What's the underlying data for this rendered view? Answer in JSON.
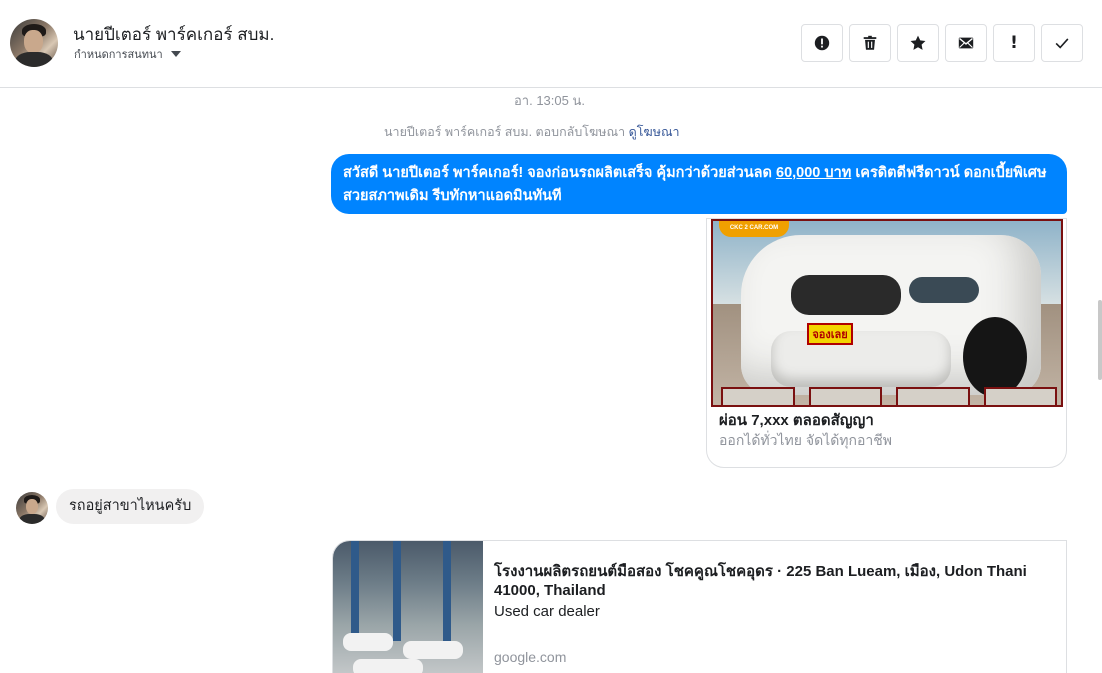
{
  "header": {
    "contact_name": "นายปีเตอร์ พาร์คเกอร์ สบม.",
    "settings_label": "กำหนดการสนทนา",
    "toolbar": [
      {
        "icon": "alert-circle-icon",
        "label": "report"
      },
      {
        "icon": "trash-icon",
        "label": "delete"
      },
      {
        "icon": "star-icon",
        "label": "star"
      },
      {
        "icon": "envelope-icon",
        "label": "mark-unread"
      },
      {
        "icon": "exclamation-icon",
        "label": "!"
      },
      {
        "icon": "check-icon",
        "label": "done"
      }
    ]
  },
  "thread": {
    "timestamp": "อา. 13:05 น.",
    "ad_reply_prefix": "นายปีเตอร์ พาร์คเกอร์ สบม. ตอบกลับโฆษณา",
    "ad_reply_link": "ดูโฆษณา",
    "outgoing": {
      "text_before": "สวัสดี นายปีเตอร์ พาร์คเกอร์! จองก่อนรถผลิตเสร็จ คุ้มกว่าด้วยส่วนลด ",
      "highlight": "60,000 บาท",
      "text_after": " เครดิตดีฟรีดาวน์ ดอกเบี้ยพิเศษ สวยสภาพเดิม รีบทักหาแอดมินทันที"
    },
    "ad_card": {
      "logo_text": "CKC 2 CAR.COM",
      "badge_text": "จองเลย",
      "title": "ผ่อน 7,xxx ตลอดสัญญา",
      "subtitle": "ออกได้ทั่วไทย จัดได้ทุกอาชีพ"
    },
    "incoming": {
      "text": "รถอยู่สาขาไหนครับ"
    },
    "location_card": {
      "title": "โรงงานผลิตรถยนต์มือสอง โชคคูณโชคอุดร · 225 Ban Lueam, เมือง, Udon Thani 41000, Thailand",
      "description": "Used car dealer",
      "domain": "google.com"
    }
  }
}
